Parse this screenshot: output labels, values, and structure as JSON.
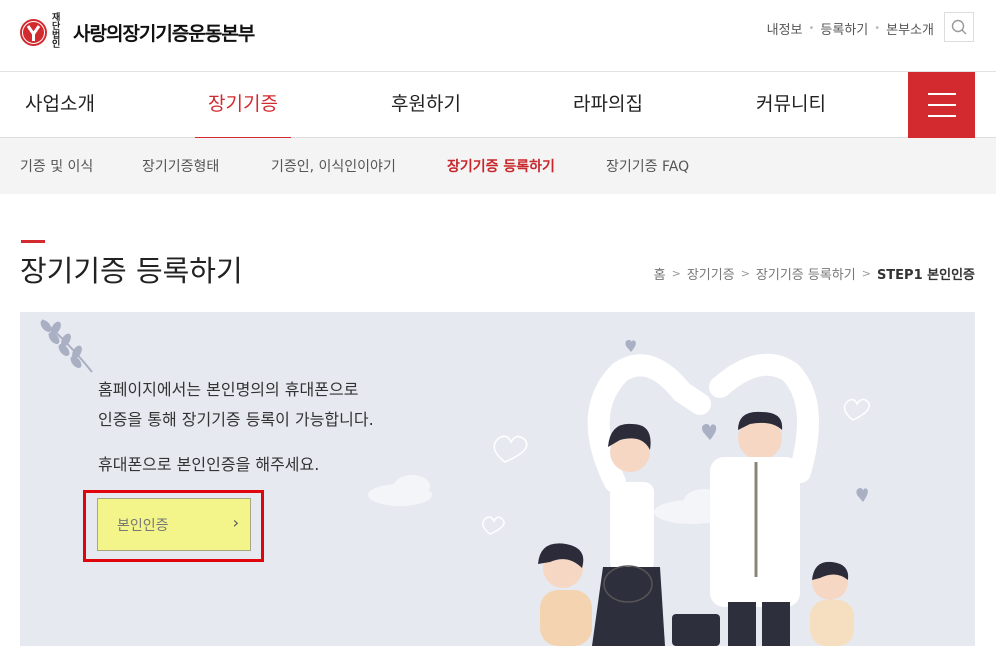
{
  "header": {
    "logo_sub": "재단법인",
    "logo_name": "사랑의장기기증운동본부",
    "util_links": [
      "내정보",
      "등록하기",
      "본부소개"
    ],
    "search_icon": "search-icon",
    "menu_icon": "hamburger-icon"
  },
  "gnb": {
    "items": [
      "사업소개",
      "장기기증",
      "후원하기",
      "라파의집",
      "커뮤니티"
    ],
    "active_index": 1
  },
  "lnb": {
    "items": [
      "기증 및 이식",
      "장기기증형태",
      "기증인, 이식인이야기",
      "장기기증 등록하기",
      "장기기증 FAQ"
    ],
    "active_index": 3
  },
  "page": {
    "title": "장기기증 등록하기",
    "breadcrumb": [
      "홈",
      "장기기증",
      "장기기증 등록하기",
      "STEP1 본인인증"
    ]
  },
  "visual": {
    "line1": "홈페이지에서는 본인명의의 휴대폰으로",
    "line2": "인증을 통해 장기기증 등록이 가능합니다.",
    "line3": "휴대폰으로 본인인증을 해주세요.",
    "button_label": "본인인증",
    "button_arrow": "›"
  },
  "colors": {
    "brand_red": "#d32a2f",
    "banner_bg": "#e7e9f1",
    "button_bg": "#f3f58a",
    "highlight_border": "#e0050d"
  }
}
